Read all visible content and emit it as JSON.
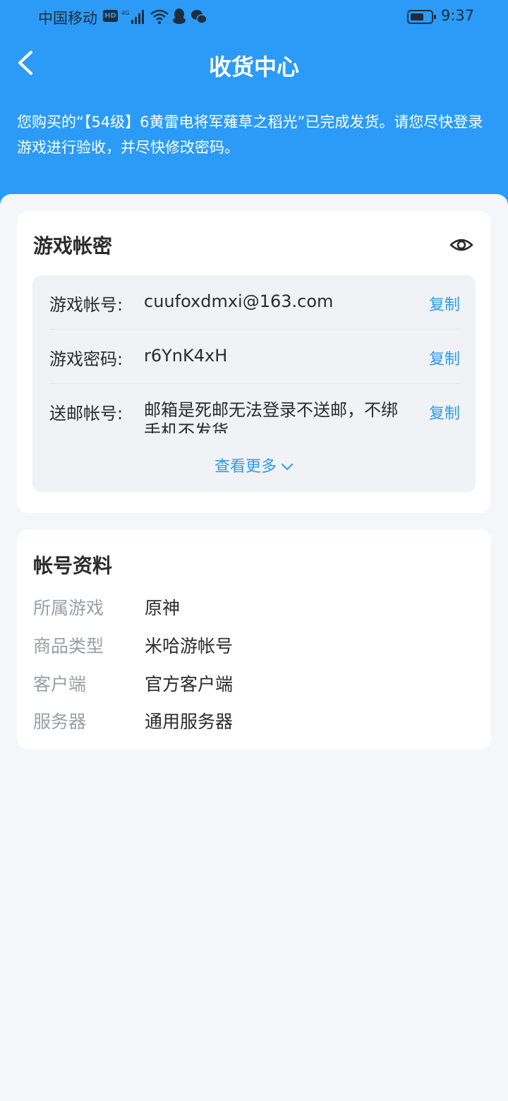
{
  "status_bar": {
    "carrier": "中国移动",
    "hd_badge": "HD",
    "time": "9:37"
  },
  "header": {
    "title": "收货中心",
    "notice": "您购买的“【54级】6黄雷电将军薙草之稻光”已完成发货。请您尽快登录游戏进行验收，并尽快修改密码。"
  },
  "credentials": {
    "title": "游戏帐密",
    "rows": [
      {
        "label": "游戏帐号:",
        "value": "cuufoxdmxi@163.com",
        "copy": "复制"
      },
      {
        "label": "游戏密码:",
        "value": "r6YnK4xH",
        "copy": "复制"
      },
      {
        "label": "送邮帐号:",
        "value": "邮箱是死邮无法登录不送邮，不绑手机不发货",
        "copy": "复制"
      }
    ],
    "more_label": "查看更多"
  },
  "profile": {
    "title": "帐号资料",
    "rows": [
      {
        "key": "所属游戏",
        "value": "原神"
      },
      {
        "key": "商品类型",
        "value": "米哈游帐号"
      },
      {
        "key": "客户端",
        "value": "官方客户端"
      },
      {
        "key": "服务器",
        "value": "通用服务器"
      }
    ]
  },
  "colors": {
    "header_blue": "#2b9bf7",
    "link_blue": "#2f9be8",
    "page_bg": "#f4f6f9"
  },
  "icons": [
    "back-arrow-icon",
    "eye-icon",
    "chevron-down-icon",
    "signal-icon",
    "wifi-icon",
    "qq-icon",
    "wechat-icon",
    "battery-icon"
  ]
}
